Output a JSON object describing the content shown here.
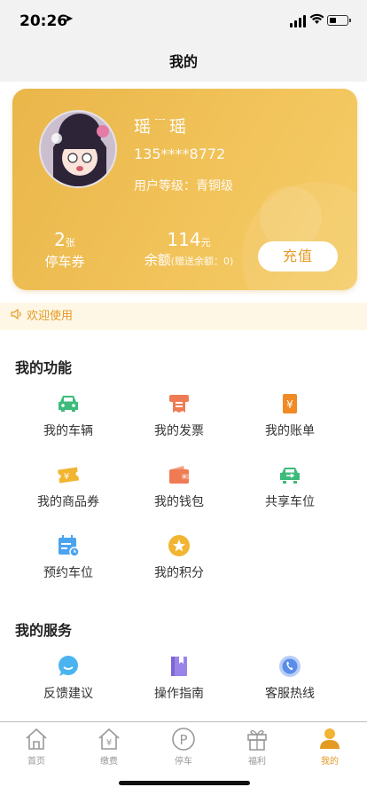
{
  "status_bar": {
    "time": "20:26"
  },
  "nav": {
    "title": "我的"
  },
  "profile": {
    "name": "瑶﹉瑶",
    "phone": "135****8772",
    "level_label": "用户等级：",
    "level_value": "青铜级",
    "coupon_count": "2",
    "coupon_unit": "张",
    "coupon_label": "停车券",
    "balance_value": "114",
    "balance_unit": "元",
    "balance_label": "余额",
    "balance_note": "(赠送余额：0)",
    "recharge_label": "充值"
  },
  "notice": {
    "text": "欢迎使用"
  },
  "functions": {
    "title": "我的功能",
    "items": [
      {
        "label": "我的车辆",
        "icon": "car-icon",
        "color": "#3dbb7b"
      },
      {
        "label": "我的发票",
        "icon": "invoice-icon",
        "color": "#ef7b54"
      },
      {
        "label": "我的账单",
        "icon": "bill-icon",
        "color": "#f08a24"
      },
      {
        "label": "我的商品券",
        "icon": "coupon-icon",
        "color": "#f2b531"
      },
      {
        "label": "我的钱包",
        "icon": "wallet-icon",
        "color": "#ef7b54"
      },
      {
        "label": "共享车位",
        "icon": "shared-parking-icon",
        "color": "#3dbb7b"
      },
      {
        "label": "预约车位",
        "icon": "reserve-calendar-icon",
        "color": "#4ba3f0"
      },
      {
        "label": "我的积分",
        "icon": "points-star-icon",
        "color": "#f2b531"
      }
    ]
  },
  "services": {
    "title": "我的服务",
    "items": [
      {
        "label": "反馈建议",
        "icon": "feedback-icon",
        "color": "#4ab4f0"
      },
      {
        "label": "操作指南",
        "icon": "guide-book-icon",
        "color": "#9b84e8"
      },
      {
        "label": "客服热线",
        "icon": "hotline-phone-icon",
        "color": "#5a8de8"
      }
    ]
  },
  "tabs": [
    {
      "label": "首页",
      "icon": "home-icon"
    },
    {
      "label": "缴费",
      "icon": "payment-icon"
    },
    {
      "label": "停车",
      "icon": "parking-icon"
    },
    {
      "label": "福利",
      "icon": "gift-icon"
    },
    {
      "label": "我的",
      "icon": "profile-icon",
      "active": true
    }
  ],
  "colors": {
    "accent": "#e49a22",
    "card": "#f2c45b"
  }
}
